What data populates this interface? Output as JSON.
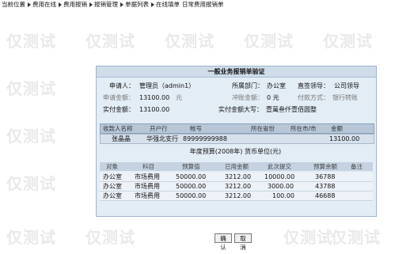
{
  "breadcrumb": [
    "当前位置",
    "费用在线",
    "费用报销",
    "报销管理",
    "单据列表",
    "在线填单"
  ],
  "breadcrumb_tail": "日常费用报销单",
  "watermark": "仅测试",
  "form": {
    "title": "一般业务报销单验证",
    "applicant_label": "申请人：",
    "applicant": "管理员（admin1）",
    "dept_label": "所属部门：",
    "dept": "办公室",
    "leader_label": "直签领导：",
    "leader": "公司领导",
    "apply_amount_label": "申请金额：",
    "apply_amount": "13100.00",
    "apply_amount_unit": "元",
    "offset_label": "冲账金额：",
    "offset": "0 元",
    "payment_label": "付款方式：",
    "payment": "银行转账",
    "actual_label": "实付金额：",
    "actual": "13100.00",
    "actual_upper_label": "实付金额大写：",
    "actual_upper": "壹萬叁仟壹佰圆整"
  },
  "payee_table": {
    "headers": [
      "收款人名称",
      "开户行",
      "帐号",
      "所在省份",
      "所在市/市",
      "金额"
    ],
    "rows": [
      [
        "张晶晶",
        "华强北支行",
        "89999999988",
        "",
        "",
        "13100.00"
      ]
    ]
  },
  "budget": {
    "title": "年度预算(2008年) 货币单位(元)",
    "headers": [
      "对象",
      "科目",
      "预算值",
      "已用金额",
      "此次提交",
      "预算余额",
      "备注"
    ],
    "rows": [
      [
        "办公室",
        "市场费用",
        "50000.00",
        "3212.00",
        "10000.00",
        "36788",
        ""
      ],
      [
        "办公室",
        "市场费用",
        "50000.00",
        "3212.00",
        "3000.00",
        "43788",
        ""
      ],
      [
        "办公室",
        "市场费用",
        "50000.00",
        "3212.00",
        "100.00",
        "46688",
        ""
      ]
    ]
  },
  "buttons": {
    "confirm": "确认",
    "cancel": "取消"
  }
}
